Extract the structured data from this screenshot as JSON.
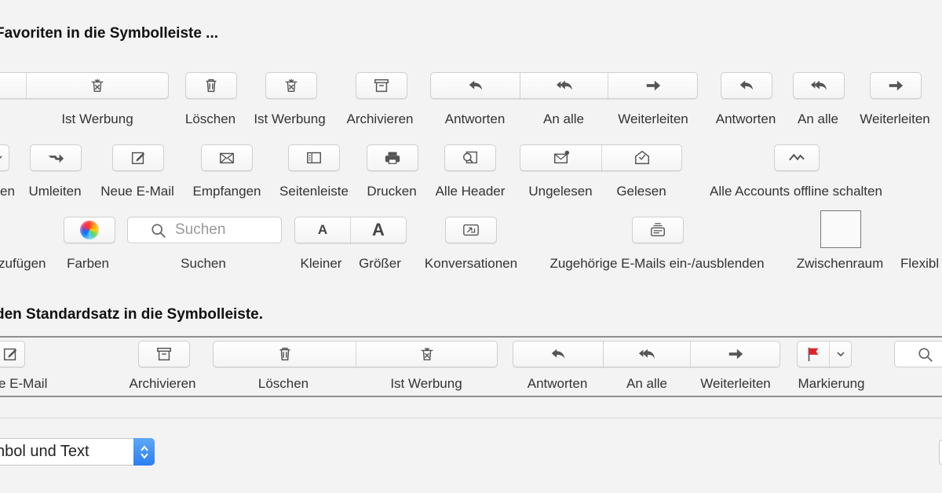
{
  "headings": {
    "favorites": "Favoriten in die Symbolleiste ...",
    "default_set": "den Standardsatz in die Symbolleiste."
  },
  "row1": {
    "ist_werbung": "Ist Werbung",
    "loeschen": "Löschen",
    "ist_werbung2": "Ist Werbung",
    "archivieren": "Archivieren",
    "antworten": "Antworten",
    "an_alle": "An alle",
    "weiterleiten": "Weiterleiten",
    "antworten2": "Antworten",
    "an_alle2": "An alle",
    "weiterleiten2": "Weiterleiten"
  },
  "row2": {
    "partial": "en",
    "umleiten": "Umleiten",
    "neue_email": "Neue E-Mail",
    "empfangen": "Empfangen",
    "seitenleiste": "Seitenleiste",
    "drucken": "Drucken",
    "alle_header": "Alle Header",
    "ungelesen": "Ungelesen",
    "gelesen": "Gelesen",
    "offline": "Alle Accounts offline schalten"
  },
  "row3": {
    "hinzufuegen_partial": "zufügen",
    "farben": "Farben",
    "suchen_placeholder": "Suchen",
    "suchen": "Suchen",
    "kleiner": "Kleiner",
    "groesser": "Größer",
    "konversationen": "Konversationen",
    "zugehoerige": "Zugehörige E-Mails ein-/ausblenden",
    "zwischenraum": "Zwischenraum",
    "flexibel_partial": "Flexibl"
  },
  "default_set": {
    "neue_email_partial": "e E-Mail",
    "archivieren": "Archivieren",
    "loeschen": "Löschen",
    "ist_werbung": "Ist Werbung",
    "antworten": "Antworten",
    "an_alle": "An alle",
    "weiterleiten": "Weiterleiten",
    "markierung": "Markierung"
  },
  "show_popup": {
    "value": "nbol und Text"
  },
  "colors": {
    "accent_blue": "#2c7ef0",
    "flag_red": "#e0242b",
    "icon_gray": "#555555"
  }
}
